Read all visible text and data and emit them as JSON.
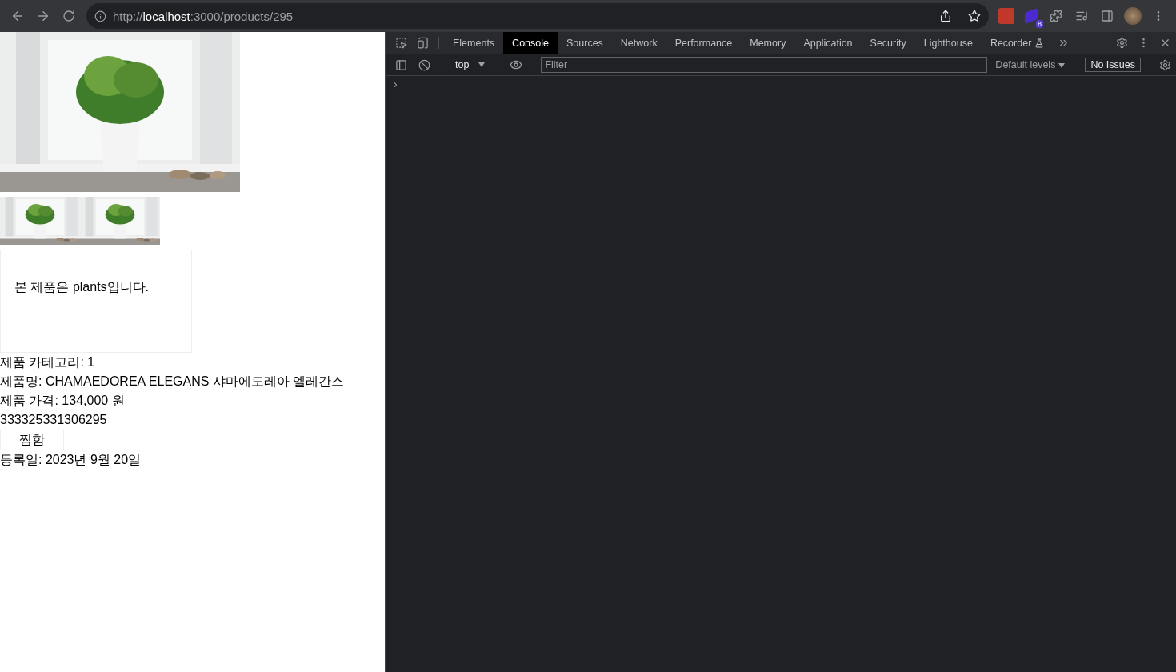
{
  "browser": {
    "url": {
      "scheme": "http://",
      "host": "localhost",
      "path": ":3000/products/295"
    },
    "extension_badge": "8"
  },
  "page": {
    "description": "본 제품은 plants입니다.",
    "lines": [
      "제품 카테고리: 1",
      "제품명: CHAMAEDOREA ELEGANS 샤마에도레아 엘레간스",
      "제품 가격: 134,000 원",
      "333325331306295"
    ],
    "wish_button": "찜함",
    "registered": "등록일: 2023년 9월 20일"
  },
  "devtools": {
    "tabs": [
      {
        "label": "Elements",
        "selected": false
      },
      {
        "label": "Console",
        "selected": true
      },
      {
        "label": "Sources",
        "selected": false
      },
      {
        "label": "Network",
        "selected": false
      },
      {
        "label": "Performance",
        "selected": false
      },
      {
        "label": "Memory",
        "selected": false
      },
      {
        "label": "Application",
        "selected": false
      },
      {
        "label": "Security",
        "selected": false
      },
      {
        "label": "Lighthouse",
        "selected": false
      },
      {
        "label": "Recorder",
        "selected": false,
        "experimental": true
      }
    ],
    "context": "top",
    "filter_placeholder": "Filter",
    "levels": "Default levels",
    "issues": "No Issues",
    "prompt": "›"
  }
}
